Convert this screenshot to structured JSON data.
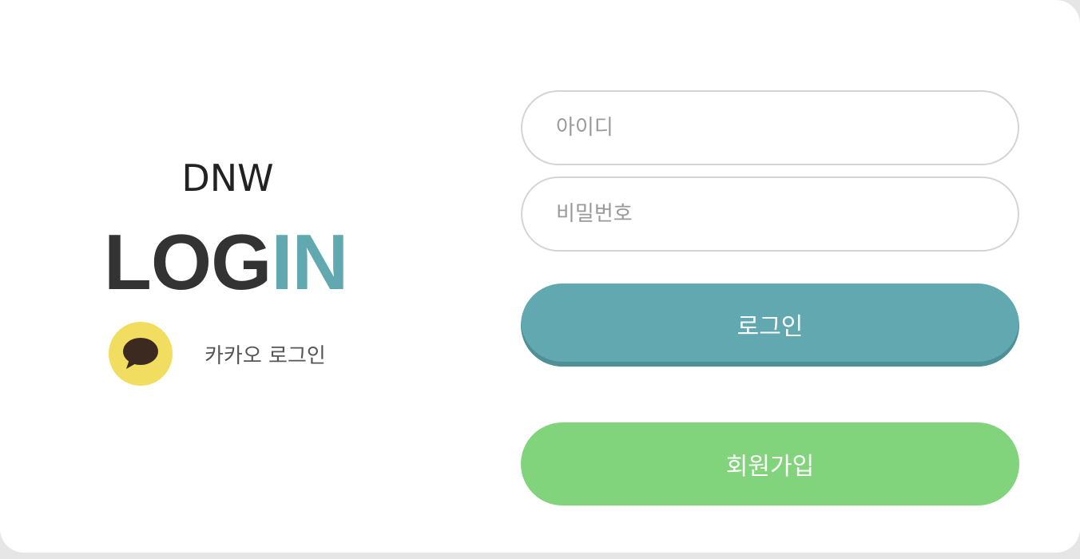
{
  "brand": {
    "name": "DNW",
    "title_dark": "LOG",
    "title_accent": "IN"
  },
  "kakao": {
    "label": "카카오 로그인",
    "icon": "speech-bubble-icon"
  },
  "form": {
    "id_placeholder": "아이디",
    "password_placeholder": "비밀번호",
    "login_label": "로그인",
    "signup_label": "회원가입"
  },
  "colors": {
    "accent_teal": "#62a8b0",
    "signup_green": "#81d47b",
    "kakao_yellow": "#f1dd5f",
    "kakao_brown": "#3c2a21",
    "text_dark": "#333333"
  }
}
